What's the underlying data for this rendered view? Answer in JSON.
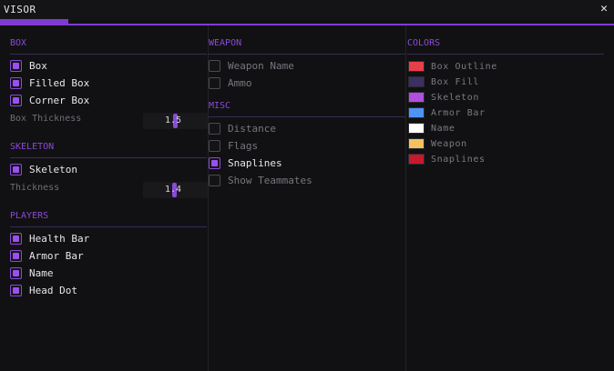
{
  "window": {
    "title": "VISOR",
    "close_glyph": "✕"
  },
  "box": {
    "header": "BOX",
    "items": [
      {
        "label": "Box",
        "checked": true
      },
      {
        "label": "Filled Box",
        "checked": true
      },
      {
        "label": "Corner Box",
        "checked": true
      }
    ],
    "thickness_label": "Box Thickness",
    "thickness_value": "1.5",
    "thickness_level": 0.5
  },
  "skeleton": {
    "header": "SKELETON",
    "items": [
      {
        "label": "Skeleton",
        "checked": true
      }
    ],
    "thickness_label": "Thickness",
    "thickness_value": "1.4",
    "thickness_level": 0.48
  },
  "players": {
    "header": "PLAYERS",
    "items": [
      {
        "label": "Health Bar",
        "checked": true
      },
      {
        "label": "Armor Bar",
        "checked": true
      },
      {
        "label": "Name",
        "checked": true
      },
      {
        "label": "Head Dot",
        "checked": true
      }
    ]
  },
  "weapon": {
    "header": "WEAPON",
    "items": [
      {
        "label": "Weapon Name",
        "checked": false
      },
      {
        "label": "Ammo",
        "checked": false
      }
    ]
  },
  "misc": {
    "header": "MISC",
    "items": [
      {
        "label": "Distance",
        "checked": false
      },
      {
        "label": "Flags",
        "checked": false
      },
      {
        "label": "Snaplines",
        "checked": true
      },
      {
        "label": "Show Teammates",
        "checked": false
      }
    ]
  },
  "colors": {
    "header": "COLORS",
    "items": [
      {
        "label": "Box Outline",
        "color": "#e8404a"
      },
      {
        "label": "Box Fill",
        "color": "#3c2f63"
      },
      {
        "label": "Skeleton",
        "color": "#b24ee0"
      },
      {
        "label": "Armor Bar",
        "color": "#4f93f3"
      },
      {
        "label": "Name",
        "color": "#ffffff"
      },
      {
        "label": "Weapon",
        "color": "#f4c060"
      },
      {
        "label": "Snaplines",
        "color": "#c8182c"
      }
    ]
  },
  "theme": {
    "accent": "#8c48d8",
    "background": "#111113"
  }
}
